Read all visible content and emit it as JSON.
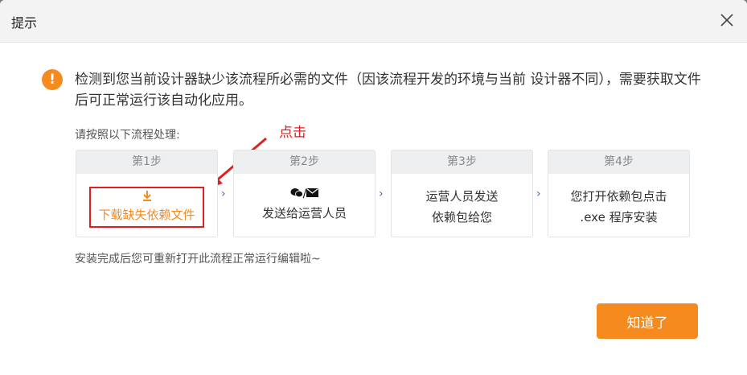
{
  "dialog": {
    "title": "提示",
    "message": "检测到您当前设计器缺少该流程所必需的文件（因该流程开发的环境与当前 设计器不同），需要获取文件后可正常运行该自动化应用。",
    "instruction": "请按照以下流程处理:",
    "annotation": "点击",
    "steps": [
      {
        "header": "第1步",
        "label": "下载缺失依赖文件"
      },
      {
        "header": "第2步",
        "icons": "/",
        "label": "发送给运营人员"
      },
      {
        "header": "第3步",
        "line1": "运营人员发送",
        "line2": "依赖包给您"
      },
      {
        "header": "第4步",
        "line1": "您打开依赖包点击",
        "line2": ".exe 程序安装"
      }
    ],
    "footer_note": "安装完成后您可重新打开此流程正常运行编辑啦~",
    "ok_label": "知道了",
    "colors": {
      "accent": "#f58a1f",
      "highlight": "#e02020"
    }
  }
}
